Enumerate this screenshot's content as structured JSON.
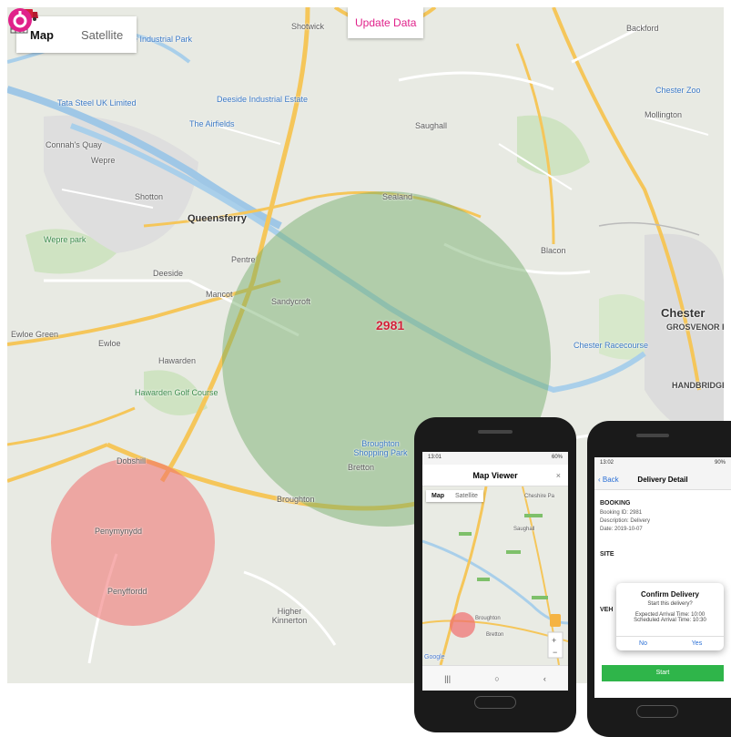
{
  "map": {
    "type_control": {
      "map_label": "Map",
      "satellite_label": "Satellite"
    },
    "update_button": "Update Data",
    "places": [
      "Shotwick",
      "Backford",
      "Deeside Industrial Park",
      "Tata Steel UK Limited",
      "Deeside Industrial Estate",
      "The Airfields",
      "Connah's Quay",
      "Wepre",
      "Shotton",
      "Queensferry",
      "Sealand",
      "Saughall",
      "Mollington",
      "Chester Zoo",
      "Wepre park",
      "Pentre",
      "Deeside",
      "Blacon",
      "Mancot",
      "Sandycroft",
      "Chester",
      "GROSVENOR PRECINCT",
      "Ewloe Green",
      "Ewloe",
      "Hawarden",
      "Chester Racecourse",
      "Hawarden Golf Course",
      "HANDBRIDGE",
      "Broughton Shopping Park",
      "Bretton",
      "Broughton",
      "Dobshill",
      "Penymynydd",
      "Penyffordd",
      "Higher Kinnerton",
      "Ewloe Green"
    ],
    "marker": {
      "label": "2981",
      "icon": "delivery-truck-icon",
      "color": "#d4213a"
    },
    "zones": [
      {
        "name": "geofence-green",
        "color": "#8cc084"
      },
      {
        "name": "geofence-red",
        "color": "#f08080"
      }
    ],
    "brand_icon": "brand-logo-icon",
    "accent": "#e0218a"
  },
  "phone_left": {
    "status_left": "13:01",
    "status_right": "60%",
    "title": "Map Viewer",
    "close": "×",
    "tabs": [
      "Map",
      "Satellite"
    ],
    "places": [
      "Cheshire Pa",
      "Saughall",
      "Broughton",
      "Bretton"
    ],
    "google": "Google",
    "nav": [
      "|||",
      "○",
      "‹"
    ]
  },
  "phone_right": {
    "status_left": "13:02",
    "status_right": "90%",
    "back": "‹ Back",
    "title": "Delivery Detail",
    "booking_heading": "BOOKING",
    "booking_lines": [
      "Booking ID: 2981",
      "Description: Delivery",
      "Date: 2019-10-07"
    ],
    "site_heading": "SITE",
    "vehicle_heading": "VEH",
    "dialog": {
      "title": "Confirm Delivery",
      "question": "Start this delivery?",
      "line1": "Expected Arrival Time: 10:00",
      "line2": "Scheduled Arrival Time: 10:30",
      "no": "No",
      "yes": "Yes"
    },
    "start_button": "Start"
  }
}
